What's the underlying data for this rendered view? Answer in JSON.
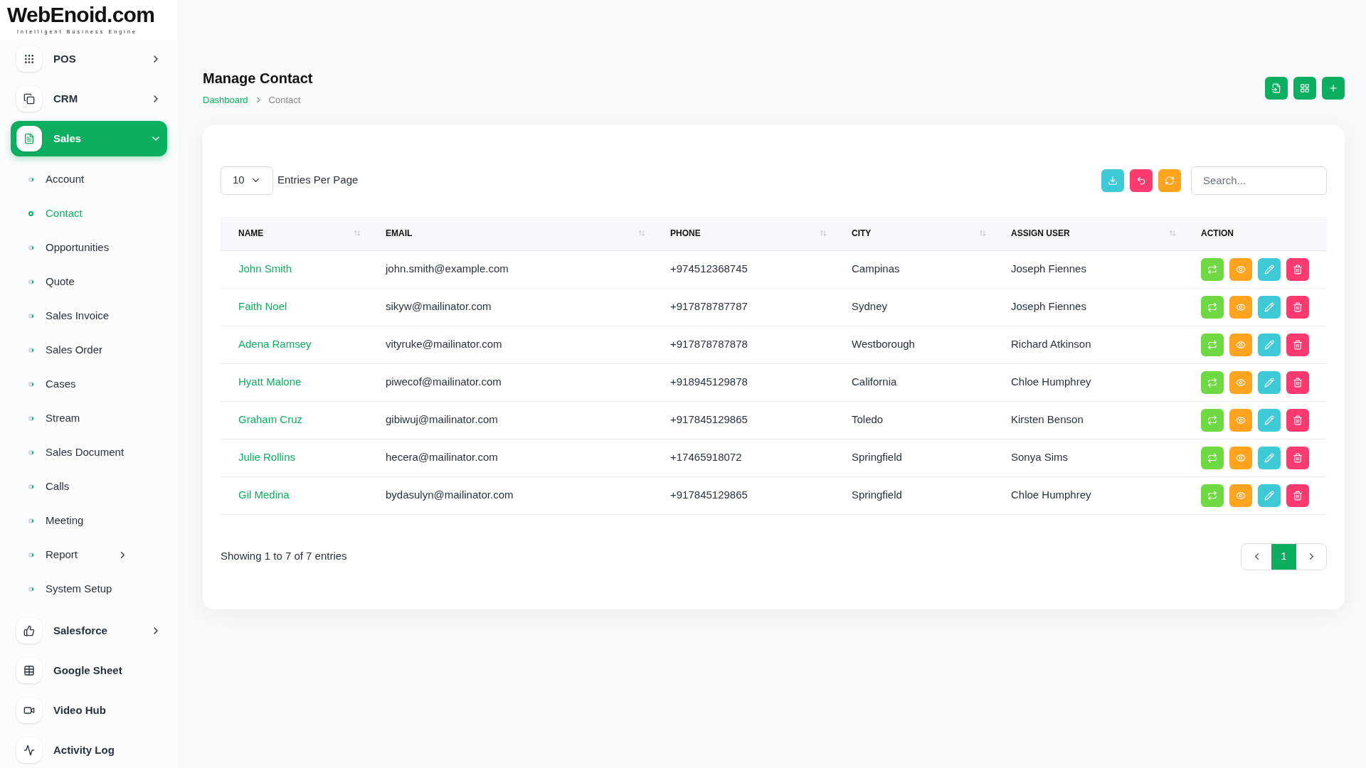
{
  "logo": {
    "name": "WebEnoid.com",
    "tagline": "Intelligent Business Engine"
  },
  "sidebar": {
    "items": [
      {
        "label": "POS",
        "selected": false,
        "expanded": false
      },
      {
        "label": "CRM",
        "selected": false,
        "expanded": false
      },
      {
        "label": "Sales",
        "selected": true,
        "expanded": true,
        "children": [
          {
            "label": "Account",
            "selected": false
          },
          {
            "label": "Contact",
            "selected": true
          },
          {
            "label": "Opportunities",
            "selected": false
          },
          {
            "label": "Quote",
            "selected": false
          },
          {
            "label": "Sales Invoice",
            "selected": false
          },
          {
            "label": "Sales Order",
            "selected": false
          },
          {
            "label": "Cases",
            "selected": false
          },
          {
            "label": "Stream",
            "selected": false
          },
          {
            "label": "Sales Document",
            "selected": false
          },
          {
            "label": "Calls",
            "selected": false
          },
          {
            "label": "Meeting",
            "selected": false
          },
          {
            "label": "Report",
            "selected": false,
            "expanded": false
          },
          {
            "label": "System Setup",
            "selected": false
          }
        ]
      },
      {
        "label": "Salesforce",
        "selected": false,
        "expanded": false
      },
      {
        "label": "Google Sheet",
        "selected": false
      },
      {
        "label": "Video Hub",
        "selected": false
      },
      {
        "label": "Activity Log",
        "selected": false
      }
    ]
  },
  "page": {
    "title": "Manage Contact",
    "breadcrumb": [
      "Dashboard",
      "Contact"
    ]
  },
  "header_actions": [
    {
      "kind": "import"
    },
    {
      "kind": "grid"
    },
    {
      "kind": "add"
    }
  ],
  "toolbar": {
    "per_page": "10",
    "per_page_label": "Entries Per Page",
    "buttons": [
      {
        "kind": "download",
        "color": "#3ec9d6"
      },
      {
        "kind": "undo",
        "color": "#ff3a6e"
      },
      {
        "kind": "refresh",
        "color": "#ffa21d"
      }
    ],
    "search": {
      "placeholder": "Search..."
    }
  },
  "table": {
    "columns": [
      {
        "label": "NAME",
        "sortable": true
      },
      {
        "label": "EMAIL",
        "sortable": true
      },
      {
        "label": "PHONE",
        "sortable": true
      },
      {
        "label": "CITY",
        "sortable": true
      },
      {
        "label": "ASSIGN USER",
        "sortable": true
      },
      {
        "label": "ACTION",
        "sortable": false
      }
    ],
    "row_actions": [
      {
        "kind": "convert",
        "color": "#6fd943"
      },
      {
        "kind": "view",
        "color": "#ffa21d"
      },
      {
        "kind": "edit",
        "color": "#3ec9d6"
      },
      {
        "kind": "delete",
        "color": "#ff3a6e"
      }
    ],
    "rows": [
      [
        "John Smith",
        "john.smith@example.com",
        "+974512368745",
        "Campinas",
        "Joseph Fiennes"
      ],
      [
        "Faith Noel",
        "sikyw@mailinator.com",
        "+917878787787",
        "Sydney",
        "Joseph Fiennes"
      ],
      [
        "Adena Ramsey",
        "vityruke@mailinator.com",
        "+917878787878",
        "Westborough",
        "Richard Atkinson"
      ],
      [
        "Hyatt Malone",
        "piwecof@mailinator.com",
        "+918945129878",
        "California",
        "Chloe Humphrey"
      ],
      [
        "Graham Cruz",
        "gibiwuj@mailinator.com",
        "+917845129865",
        "Toledo",
        "Kirsten Benson"
      ],
      [
        "Julie Rollins",
        "hecera@mailinator.com",
        "+17465918072",
        "Springfield",
        "Sonya Sims"
      ],
      [
        "Gil Medina",
        "bydasulyn@mailinator.com",
        "+917845129865",
        "Springfield",
        "Chloe Humphrey"
      ]
    ]
  },
  "footer": {
    "summary": "Showing 1 to 7 of 7 entries",
    "pages": [
      {
        "label": "1",
        "selected": true
      }
    ]
  }
}
